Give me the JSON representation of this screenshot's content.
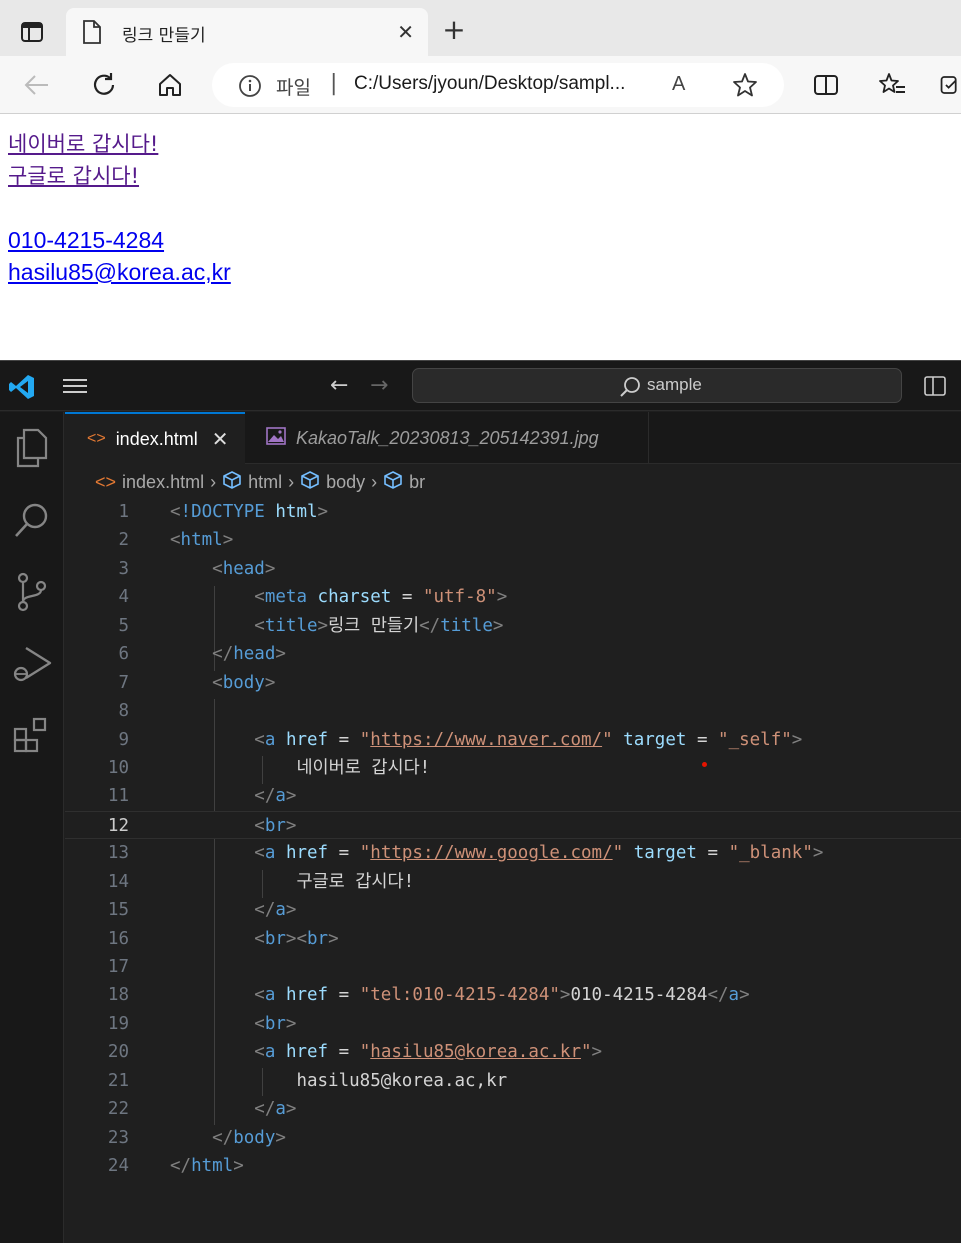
{
  "browser": {
    "tab_title": "링크 만들기",
    "new_tab_label": "+",
    "address": {
      "scheme_label": "파일",
      "separator": "|",
      "url": "C:/Users/jyoun/Desktop/sampl...",
      "read_aloud": "A"
    }
  },
  "page": {
    "links": [
      {
        "text": "네이버로 갑시다!"
      },
      {
        "text": "구글로 갑시다!"
      },
      {
        "text": "010-4215-4284"
      },
      {
        "text": "hasilu85@korea.ac,kr"
      }
    ]
  },
  "vscode": {
    "command_center": "sample",
    "tabs": [
      {
        "label": "index.html",
        "icon": "html-icon",
        "close": "✕"
      },
      {
        "label": "KakaoTalk_20230813_205142391.jpg",
        "icon": "image-icon"
      }
    ],
    "breadcrumbs": [
      "index.html",
      "html",
      "body",
      "br"
    ],
    "current_line": 12,
    "lines": [
      {
        "n": "1"
      },
      {
        "n": "2"
      },
      {
        "n": "3"
      },
      {
        "n": "4"
      },
      {
        "n": "5"
      },
      {
        "n": "6"
      },
      {
        "n": "7"
      },
      {
        "n": "8"
      },
      {
        "n": "9"
      },
      {
        "n": "10"
      },
      {
        "n": "11"
      },
      {
        "n": "12"
      },
      {
        "n": "13"
      },
      {
        "n": "14"
      },
      {
        "n": "15"
      },
      {
        "n": "16"
      },
      {
        "n": "17"
      },
      {
        "n": "18"
      },
      {
        "n": "19"
      },
      {
        "n": "20"
      },
      {
        "n": "21"
      },
      {
        "n": "22"
      },
      {
        "n": "23"
      },
      {
        "n": "24"
      }
    ],
    "code": {
      "doctype": "!DOCTYPE",
      "html": "html",
      "head": "head",
      "meta": "meta",
      "charset": "charset",
      "utf8": "\"utf-8\"",
      "title": "title",
      "title_text": "링크 만들기",
      "body": "body",
      "a": "a",
      "href": "href",
      "target": "target",
      "br": "br",
      "naver_url": "https://www.naver.com/",
      "self": "\"_self\"",
      "naver_text": "네이버로 갑시다!",
      "google_url": "https://www.google.com/",
      "blank": "\"_blank\"",
      "google_text": "구글로 갑시다!",
      "tel_href": "\"tel:010-4215-4284\"",
      "tel_text": "010-4215-4284",
      "mail_href": "hasilu85@korea.ac.kr",
      "mail_text": "hasilu85@korea.ac,kr"
    }
  },
  "colors": {
    "tag": "#569cd6",
    "attr": "#9cdcfe",
    "string": "#ce9178",
    "punct": "#808080",
    "visited_link": "#551a8b",
    "link": "#0000ee"
  }
}
